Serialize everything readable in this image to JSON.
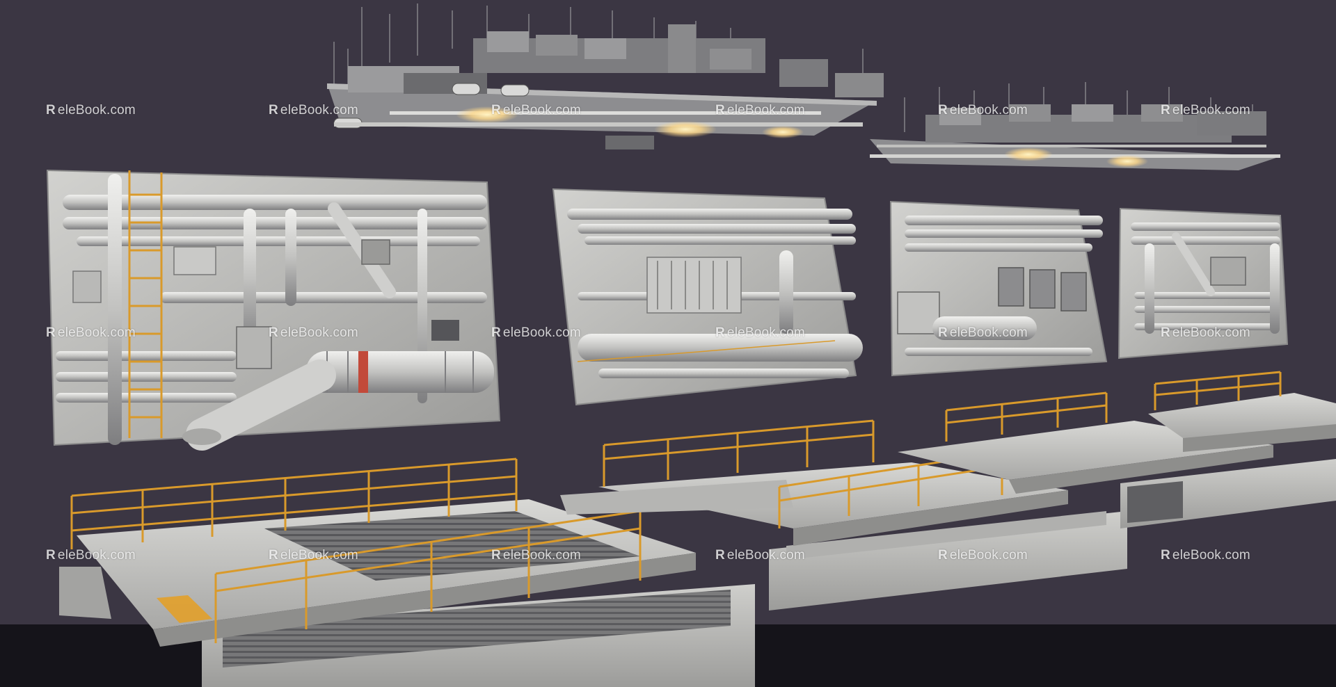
{
  "watermark": {
    "logo": "R",
    "text": "eleBook.com"
  },
  "colors": {
    "background": "#3b3643",
    "floor": "#15141a",
    "metal_light": "#c9c9c6",
    "metal_mid": "#9a9a98",
    "metal_dark": "#6c6c6e",
    "railing_orange": "#d99a2b",
    "light_glow": "#ffd98a"
  },
  "objects": [
    {
      "name": "ceiling-duct-module-large",
      "kind": "ceiling ducts with lights"
    },
    {
      "name": "ceiling-duct-module-small",
      "kind": "ceiling ducts with lights"
    },
    {
      "name": "wall-pipe-panel-1",
      "kind": "wall pipe panel"
    },
    {
      "name": "wall-pipe-panel-2",
      "kind": "wall pipe panel"
    },
    {
      "name": "wall-pipe-panel-3",
      "kind": "wall pipe panel"
    },
    {
      "name": "wall-pipe-panel-4",
      "kind": "wall pipe panel"
    },
    {
      "name": "walkway-platform-1",
      "kind": "walkway with railing"
    },
    {
      "name": "walkway-platform-2",
      "kind": "walkway with railing"
    },
    {
      "name": "walkway-platform-3",
      "kind": "walkway with railing"
    },
    {
      "name": "walkway-platform-4",
      "kind": "walkway with railing"
    }
  ]
}
